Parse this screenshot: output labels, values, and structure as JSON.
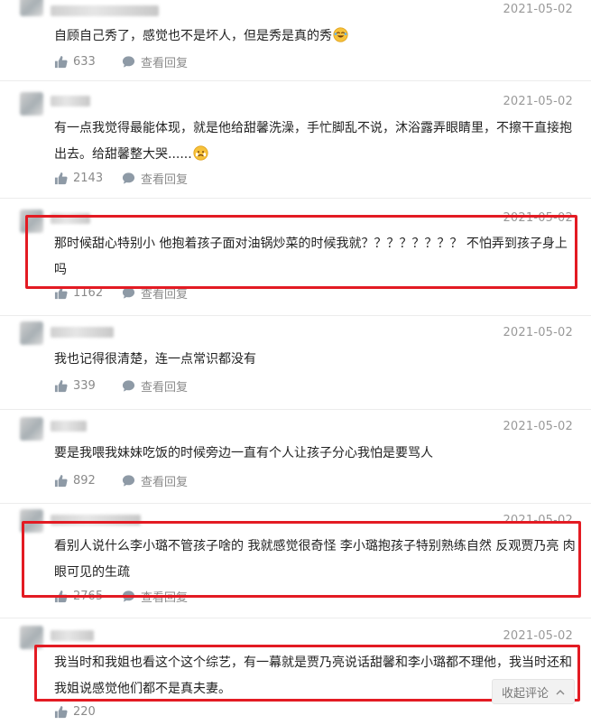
{
  "comments": [
    {
      "date": "2021-05-02",
      "text": "自顾自己秀了，感觉也不是坏人，但是秀是真的秀",
      "emoji": "laughing-crying-emoji",
      "likes": "633",
      "reply_label": "查看回复"
    },
    {
      "date": "2021-05-02",
      "text": "有一点我觉得最能体现，就是他给甜馨洗澡，手忙脚乱不说，沐浴露弄眼睛里，不擦干直接抱出去。给甜馨整大哭......",
      "emoji": "crying-face-emoji",
      "likes": "2143",
      "reply_label": "查看回复"
    },
    {
      "date": "2021-05-02",
      "text": "那时候甜心特别小 他抱着孩子面对油锅炒菜的时候我就？？？？？？？？ 不怕弄到孩子身上吗",
      "likes": "1162",
      "reply_label": "查看回复",
      "highlighted": true
    },
    {
      "date": "2021-05-02",
      "text": "我也记得很清楚，连一点常识都没有",
      "likes": "339",
      "reply_label": "查看回复"
    },
    {
      "date": "2021-05-02",
      "text": "要是我喂我妹妹吃饭的时候旁边一直有个人让孩子分心我怕是要骂人",
      "likes": "892",
      "reply_label": "查看回复"
    },
    {
      "date": "2021-05-02",
      "text": "看别人说什么李小璐不管孩子啥的 我就感觉很奇怪 李小璐抱孩子特别熟练自然 反观贾乃亮 肉眼可见的生疏",
      "likes": "2765",
      "reply_label": "查看回复",
      "highlighted": true
    },
    {
      "date": "2021-05-02",
      "text": "我当时和我姐也看这个这个综艺，有一幕就是贾乃亮说话甜馨和李小璐都不理他，我当时还和我姐说感觉他们都不是真夫妻。",
      "likes": "220",
      "highlighted": true
    }
  ],
  "collapse_button": {
    "label": "收起评论",
    "icon": "chevron-up-icon"
  },
  "icons": {
    "like": "thumbs-up-icon",
    "reply": "speech-bubble-icon"
  },
  "colors": {
    "highlight": "#e31b23",
    "meta_text": "#999999",
    "action_text": "#8a8a8a"
  }
}
